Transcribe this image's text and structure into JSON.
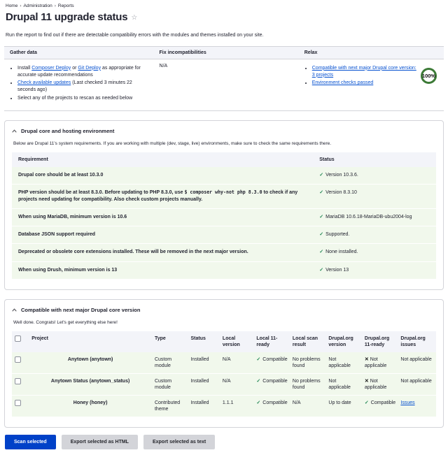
{
  "icons": {
    "star": "☆",
    "check": "✓",
    "cross": "✕",
    "bullet": "•"
  },
  "colors": {
    "primary_button": "#0041c8",
    "link": "#0550d0",
    "success_check": "#228754",
    "score_ring": "#3c7a36",
    "row_ok_background": "#f1f8ec",
    "header_background": "#f3f4f9"
  },
  "breadcrumb": {
    "separator": "›",
    "items": [
      {
        "label": "Home"
      },
      {
        "label": "Administration"
      },
      {
        "label": "Reports"
      }
    ]
  },
  "page": {
    "title": "Drupal 11 upgrade status",
    "intro": "Run the report to find out if there are detectable compatibility errors with the modules and themes installed on your site."
  },
  "summary": {
    "gather": {
      "title": "Gather data",
      "item1": {
        "pre": "Install ",
        "link1": "Composer Deploy",
        "mid": " or ",
        "link2": "Git Deploy",
        "post": " as appropriate for accurate update recommendations"
      },
      "item2": {
        "link": "Check available updates",
        "post": " (Last checked 3 minutes 22 seconds ago)"
      },
      "item3": "Select any of the projects to rescan as needed below"
    },
    "fix": {
      "title": "Fix incompatibilities",
      "value": "N/A"
    },
    "relax": {
      "title": "Relax",
      "link1": "Compatible with next major Drupal core version: 3 projects",
      "link2": "Environment checks passed",
      "score": "100%"
    }
  },
  "env_section": {
    "title": "Drupal core and hosting environment",
    "description": "Below are Drupal 11's system requirements. If you are working with multiple (dev, stage, live) environments, make sure to check the same requirements there.",
    "table": {
      "headers": {
        "requirement": "Requirement",
        "status": "Status"
      },
      "rows": [
        {
          "requirement": "Drupal core should be at least 10.3.0",
          "status": "Version 10.3.6."
        },
        {
          "requirement_pre": "PHP version should be at least 8.3.0. Before updating to PHP 8.3.0, use ",
          "code": "$ composer why-not php 8.3.0",
          "requirement_post": " to check if any projects need updating for compatibility. Also check custom projects manually.",
          "status": "Version 8.3.10"
        },
        {
          "requirement": "When using MariaDB, minimum version is 10.6",
          "status": "MariaDB 10.6.18-MariaDB-ubu2004-log"
        },
        {
          "requirement": "Database JSON support required",
          "status": "Supported."
        },
        {
          "requirement": "Deprecated or obsolete core extensions installed. These will be removed in the next major version.",
          "status": "None installed."
        },
        {
          "requirement": "When using Drush, minimum version is 13",
          "status": "Version 13"
        }
      ]
    }
  },
  "compat_section": {
    "title": "Compatible with next major Drupal core version",
    "subtitle": "Well done. Congrats! Let's get everything else here!",
    "table": {
      "headers": [
        "Project",
        "Type",
        "Status",
        "Local version",
        "Local 11-ready",
        "Local scan result",
        "Drupal.org version",
        "Drupal.org 11-ready",
        "Drupal.org issues"
      ],
      "rows": [
        {
          "project": "Anytown (anytown)",
          "type": "Custom module",
          "status": "Installed",
          "local_version": "N/A",
          "local_ready": "Compatible",
          "scan_result": "No problems found",
          "org_version": "Not applicable",
          "org_ready": "Not applicable",
          "org_issues": "Not applicable"
        },
        {
          "project": "Anytown Status (anytown_status)",
          "type": "Custom module",
          "status": "Installed",
          "local_version": "N/A",
          "local_ready": "Compatible",
          "scan_result": "No problems found",
          "org_version": "Not applicable",
          "org_ready": "Not applicable",
          "org_issues": "Not applicable"
        },
        {
          "project": "Honey (honey)",
          "type": "Contributed theme",
          "status": "Installed",
          "local_version": "1.1.1",
          "local_ready": "Compatible",
          "scan_result": "N/A",
          "org_version": "Up to date",
          "org_ready": "Compatible",
          "org_issues": "Issues"
        }
      ]
    }
  },
  "actions": {
    "scan": "Scan selected",
    "export_html": "Export selected as HTML",
    "export_text": "Export selected as text"
  }
}
